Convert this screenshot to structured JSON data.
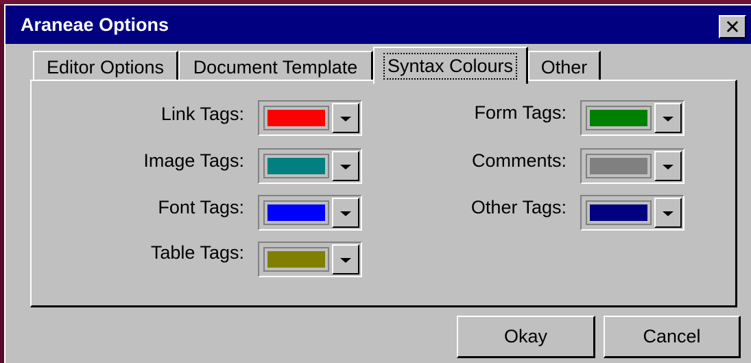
{
  "window": {
    "title": "Araneae Options",
    "close_glyph": "✕"
  },
  "tabs": [
    {
      "label": "Editor Options",
      "active": false
    },
    {
      "label": "Document Template",
      "active": false
    },
    {
      "label": "Syntax Colours",
      "active": true
    },
    {
      "label": "Other",
      "active": false
    }
  ],
  "syntax_colours": {
    "left": [
      {
        "label": "Link Tags:",
        "colour": "#ff0000"
      },
      {
        "label": "Image Tags:",
        "colour": "#008080"
      },
      {
        "label": "Font Tags:",
        "colour": "#0000ff"
      },
      {
        "label": "Table Tags:",
        "colour": "#808000"
      }
    ],
    "right": [
      {
        "label": "Form Tags:",
        "colour": "#008000"
      },
      {
        "label": "Comments:",
        "colour": "#808080"
      },
      {
        "label": "Other Tags:",
        "colour": "#000080"
      }
    ]
  },
  "buttons": {
    "okay": "Okay",
    "cancel": "Cancel"
  },
  "theme": {
    "face": "#c0c0c0",
    "titlebar": "#000080",
    "desktop": "#5a0a2c"
  },
  "icons": {
    "close": "close-icon",
    "dropdown": "chevron-down-icon"
  }
}
